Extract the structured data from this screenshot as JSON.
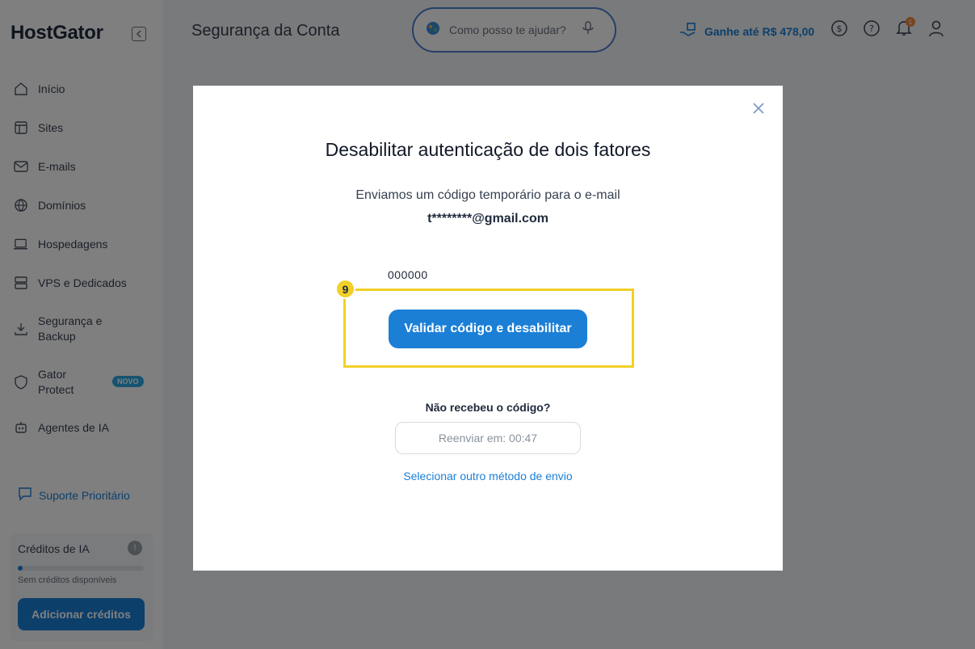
{
  "app": {
    "logo": "HostGator",
    "page_title": "Segurança da Conta"
  },
  "sidebar": {
    "items": [
      {
        "label": "Início",
        "icon": "home-icon"
      },
      {
        "label": "Sites",
        "icon": "layout-icon"
      },
      {
        "label": "E-mails",
        "icon": "mail-icon"
      },
      {
        "label": "Domínios",
        "icon": "globe-icon"
      },
      {
        "label": "Hospedagens",
        "icon": "laptop-icon"
      },
      {
        "label": "VPS e Dedicados",
        "icon": "server-icon"
      },
      {
        "label": "Segurança e Backup",
        "icon": "download-icon"
      },
      {
        "label": "Gator Protect",
        "icon": "shield-icon",
        "badge": "NOVO"
      },
      {
        "label": "Agentes de IA",
        "icon": "robot-icon"
      }
    ],
    "support_label": "Suporte Prioritário",
    "credits": {
      "title": "Créditos de IA",
      "subtitle": "Sem créditos disponíveis",
      "button": "Adicionar créditos",
      "fill_fraction": 0.03
    }
  },
  "header": {
    "search_placeholder": "Como posso te ajudar?",
    "earn_label": "Ganhe até R$ 478,00",
    "notification_count": "1"
  },
  "modal": {
    "title": "Desabilitar autenticação de dois fatores",
    "message": "Enviamos um código temporário para o e-mail",
    "email": "t********@gmail.com",
    "code_value": "000000",
    "step_number": "9",
    "primary_button": "Validar código e desabilitar",
    "resend_question": "Não recebeu o código?",
    "resend_button": "Reenviar em: 00:47",
    "alt_method_link": "Selecionar outro método de envio"
  },
  "colors": {
    "primary": "#1b7fd6",
    "highlight": "#f2d027"
  }
}
